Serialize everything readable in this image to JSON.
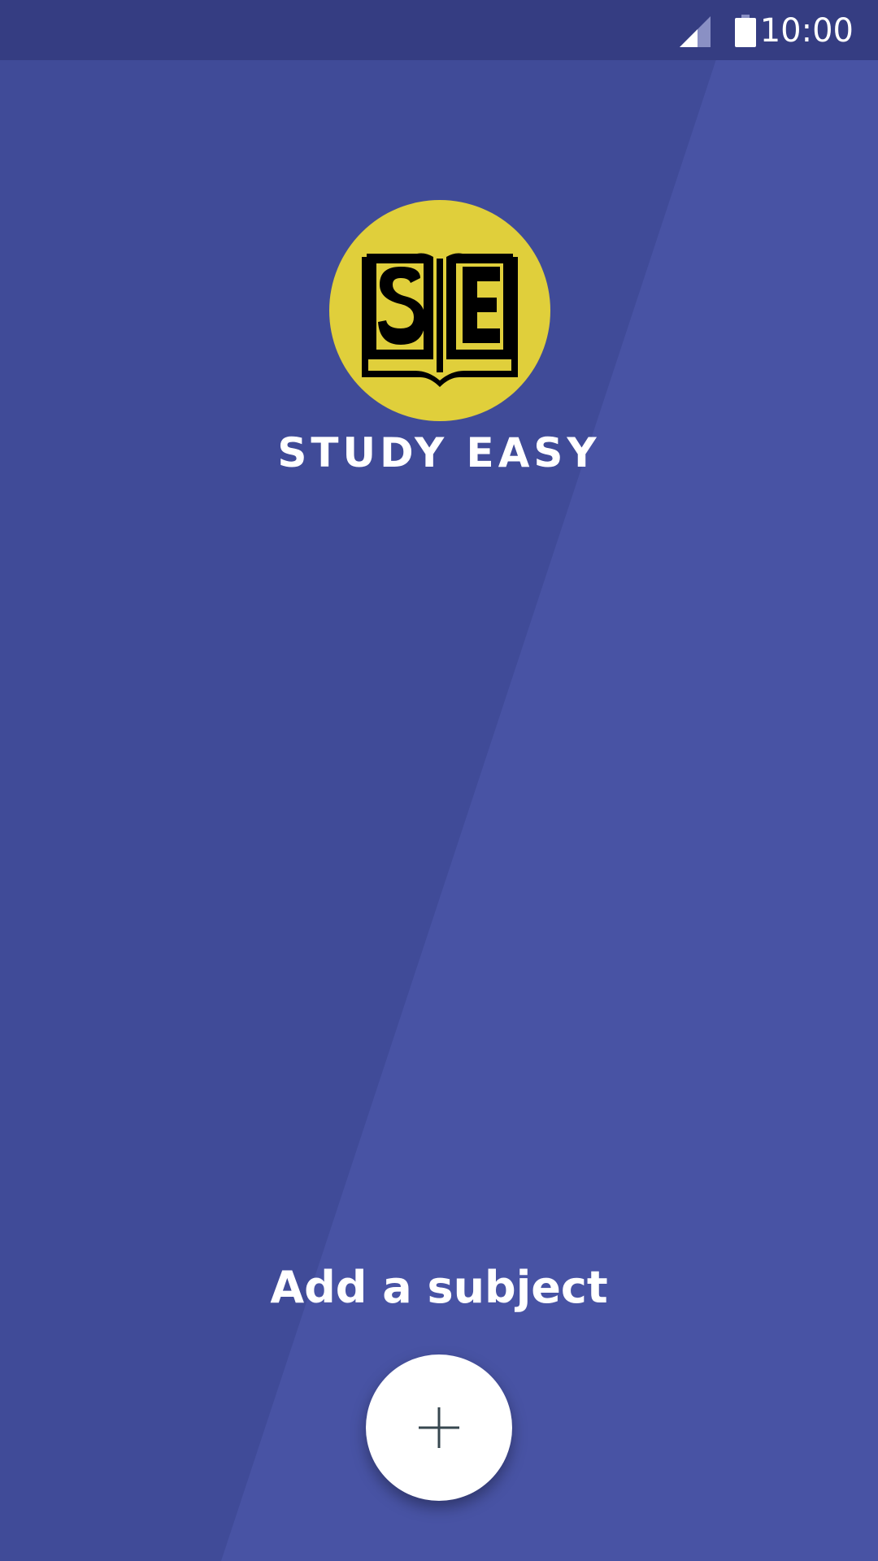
{
  "status_bar": {
    "time": "10:00",
    "signal_icon": "cell-signal-icon",
    "battery_icon": "battery-icon"
  },
  "colors": {
    "background": "#4853a4",
    "background_shade": "#404b98",
    "status_bar": "#353d82",
    "logo_circle": "#e0cf3b",
    "logo_ink": "#000000",
    "text": "#ffffff",
    "fab": "#ffffff",
    "fab_icon": "#37474f"
  },
  "app": {
    "logo_text": "SE",
    "name": "STUDY EASY"
  },
  "main": {
    "add_label": "Add a subject",
    "add_button_icon": "plus-icon"
  }
}
